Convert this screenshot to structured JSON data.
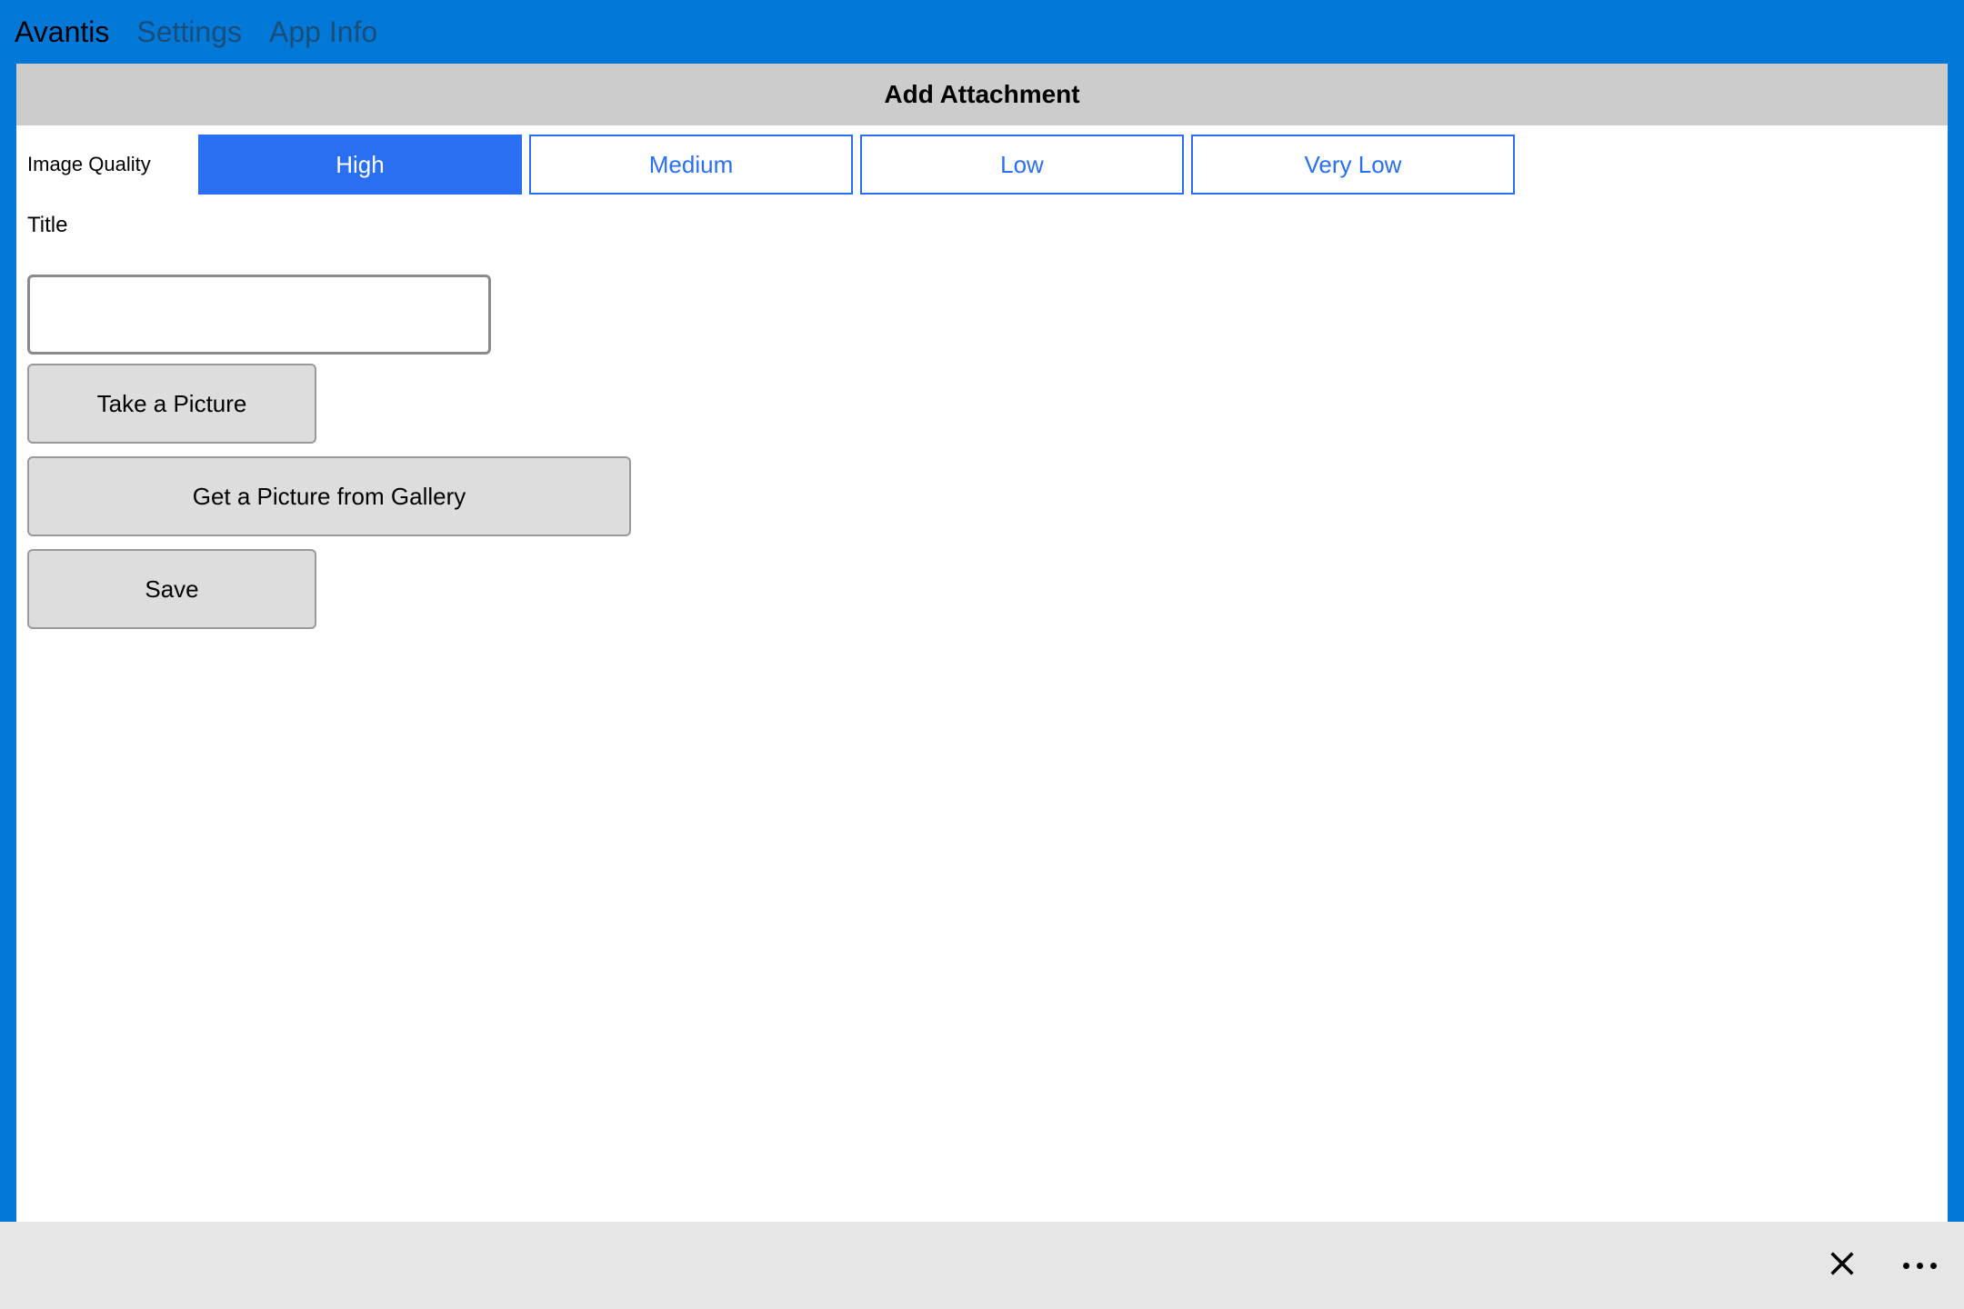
{
  "top_menu": {
    "items": [
      {
        "label": "Avantis",
        "active": true
      },
      {
        "label": "Settings",
        "active": false
      },
      {
        "label": "App Info",
        "active": false
      }
    ]
  },
  "page": {
    "title": "Add Attachment"
  },
  "quality": {
    "label": "Image Quality",
    "options": [
      {
        "label": "High",
        "active": true
      },
      {
        "label": "Medium",
        "active": false
      },
      {
        "label": "Low",
        "active": false
      },
      {
        "label": "Very Low",
        "active": false
      }
    ]
  },
  "title_field": {
    "label": "Title",
    "value": ""
  },
  "buttons": {
    "take_picture": "Take a Picture",
    "gallery": "Get a Picture from Gallery",
    "save": "Save"
  }
}
